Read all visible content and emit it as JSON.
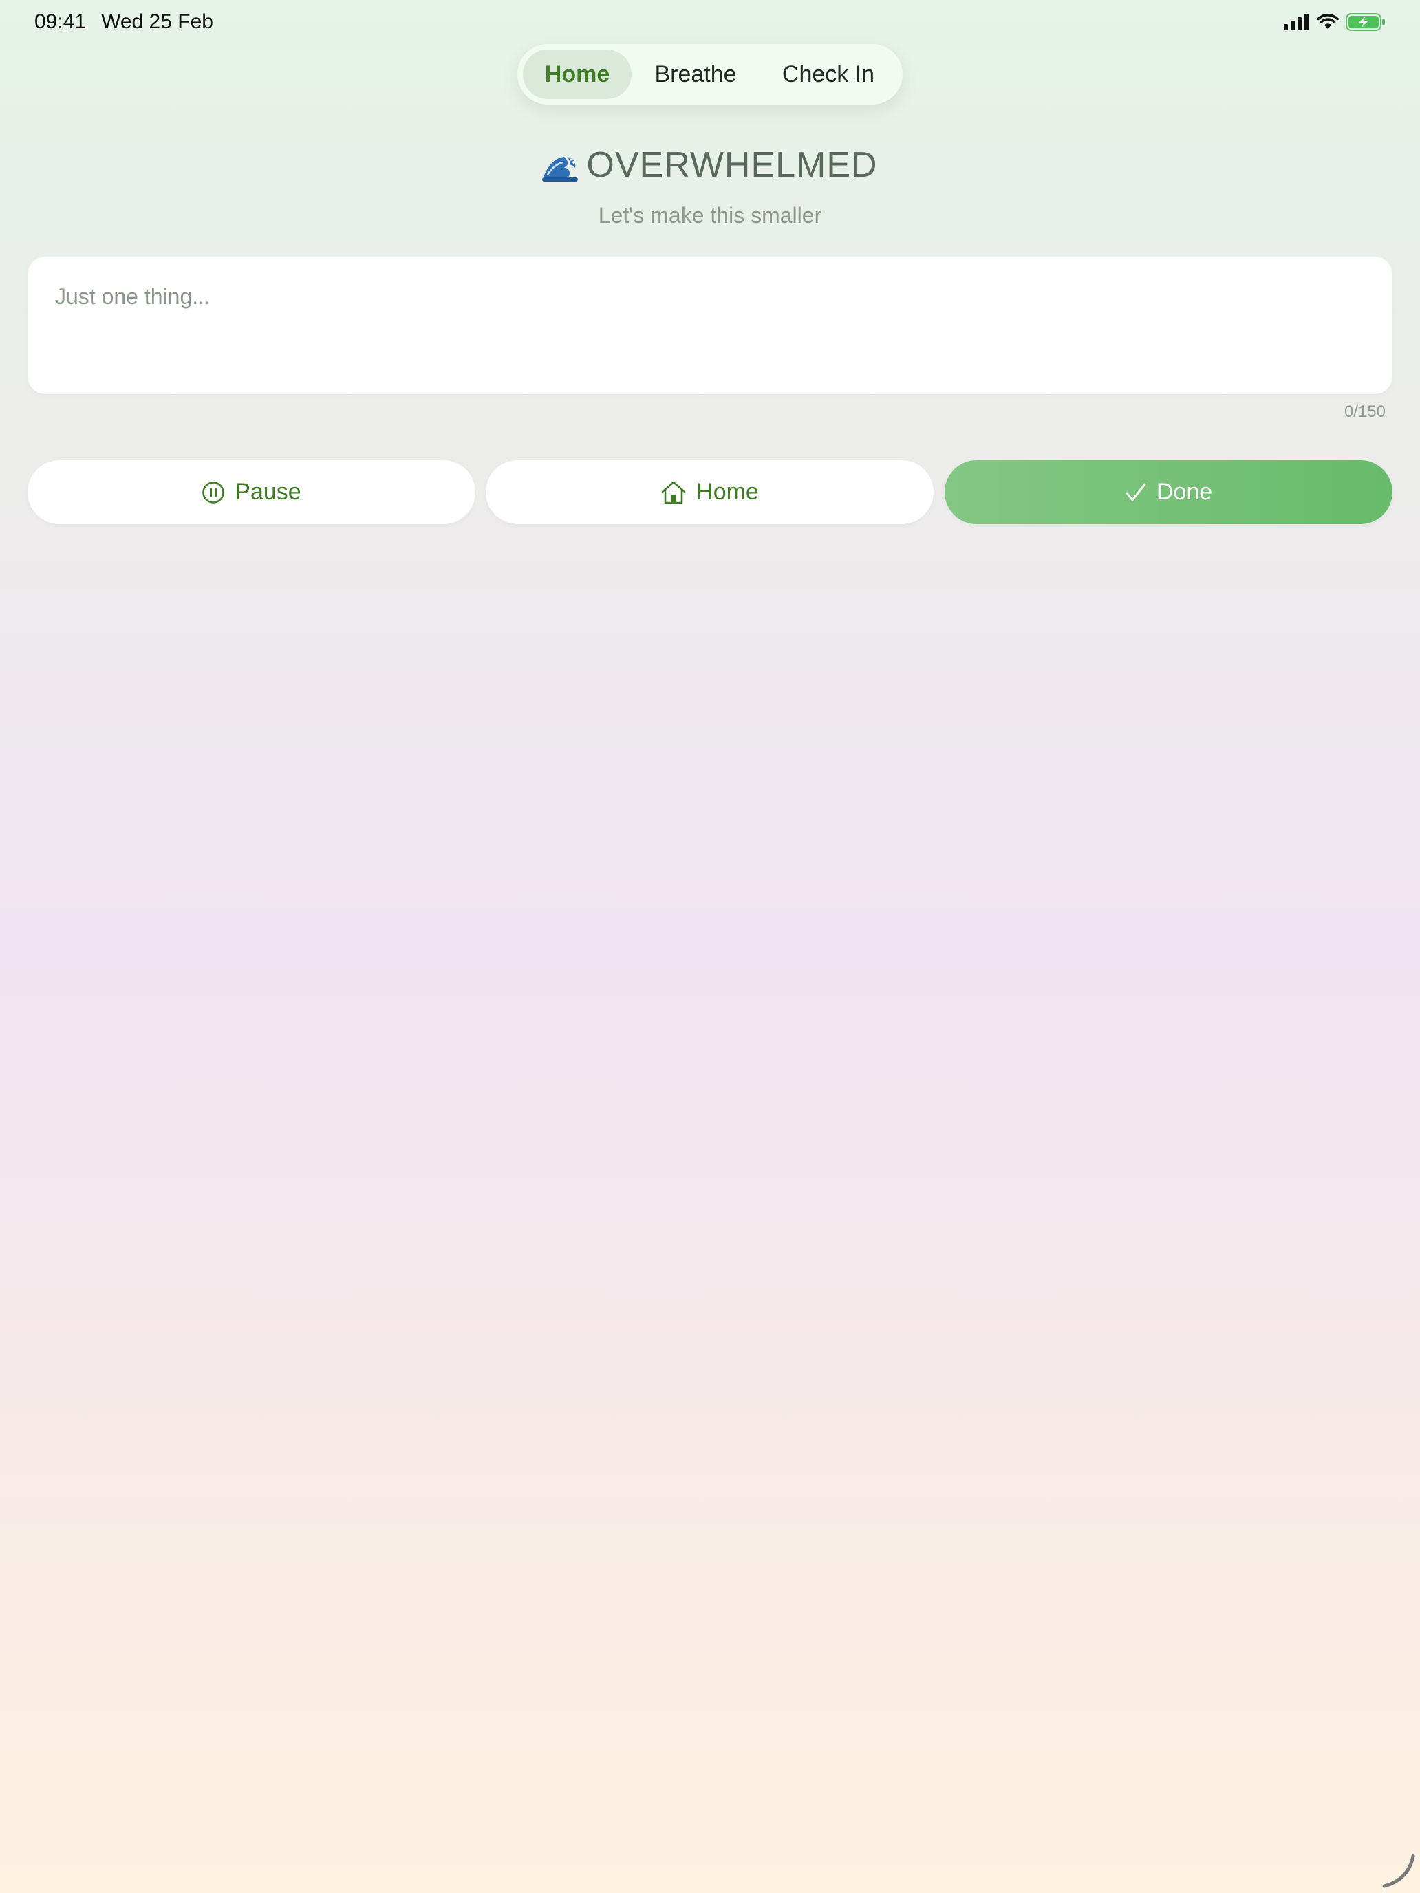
{
  "status_bar": {
    "time": "09:41",
    "date": "Wed 25 Feb",
    "icons": [
      "cellular-signal-icon",
      "wifi-icon",
      "battery-charging-icon"
    ]
  },
  "nav": {
    "tabs": [
      {
        "label": "Home",
        "active": true
      },
      {
        "label": "Breathe",
        "active": false
      },
      {
        "label": "Check In",
        "active": false
      }
    ]
  },
  "header": {
    "emoji": "wave-emoji-icon",
    "title": "OVERWHELMED",
    "subtitle": "Let's make this smaller"
  },
  "input": {
    "placeholder": "Just one thing...",
    "counter": "0/150"
  },
  "actions": {
    "pause_label": "Pause",
    "home_label": "Home",
    "done_label": "Done"
  },
  "colors": {
    "accent_green": "#3f7d24",
    "done_button": "#72c070",
    "tab_active_bg": "#dbe9db"
  }
}
